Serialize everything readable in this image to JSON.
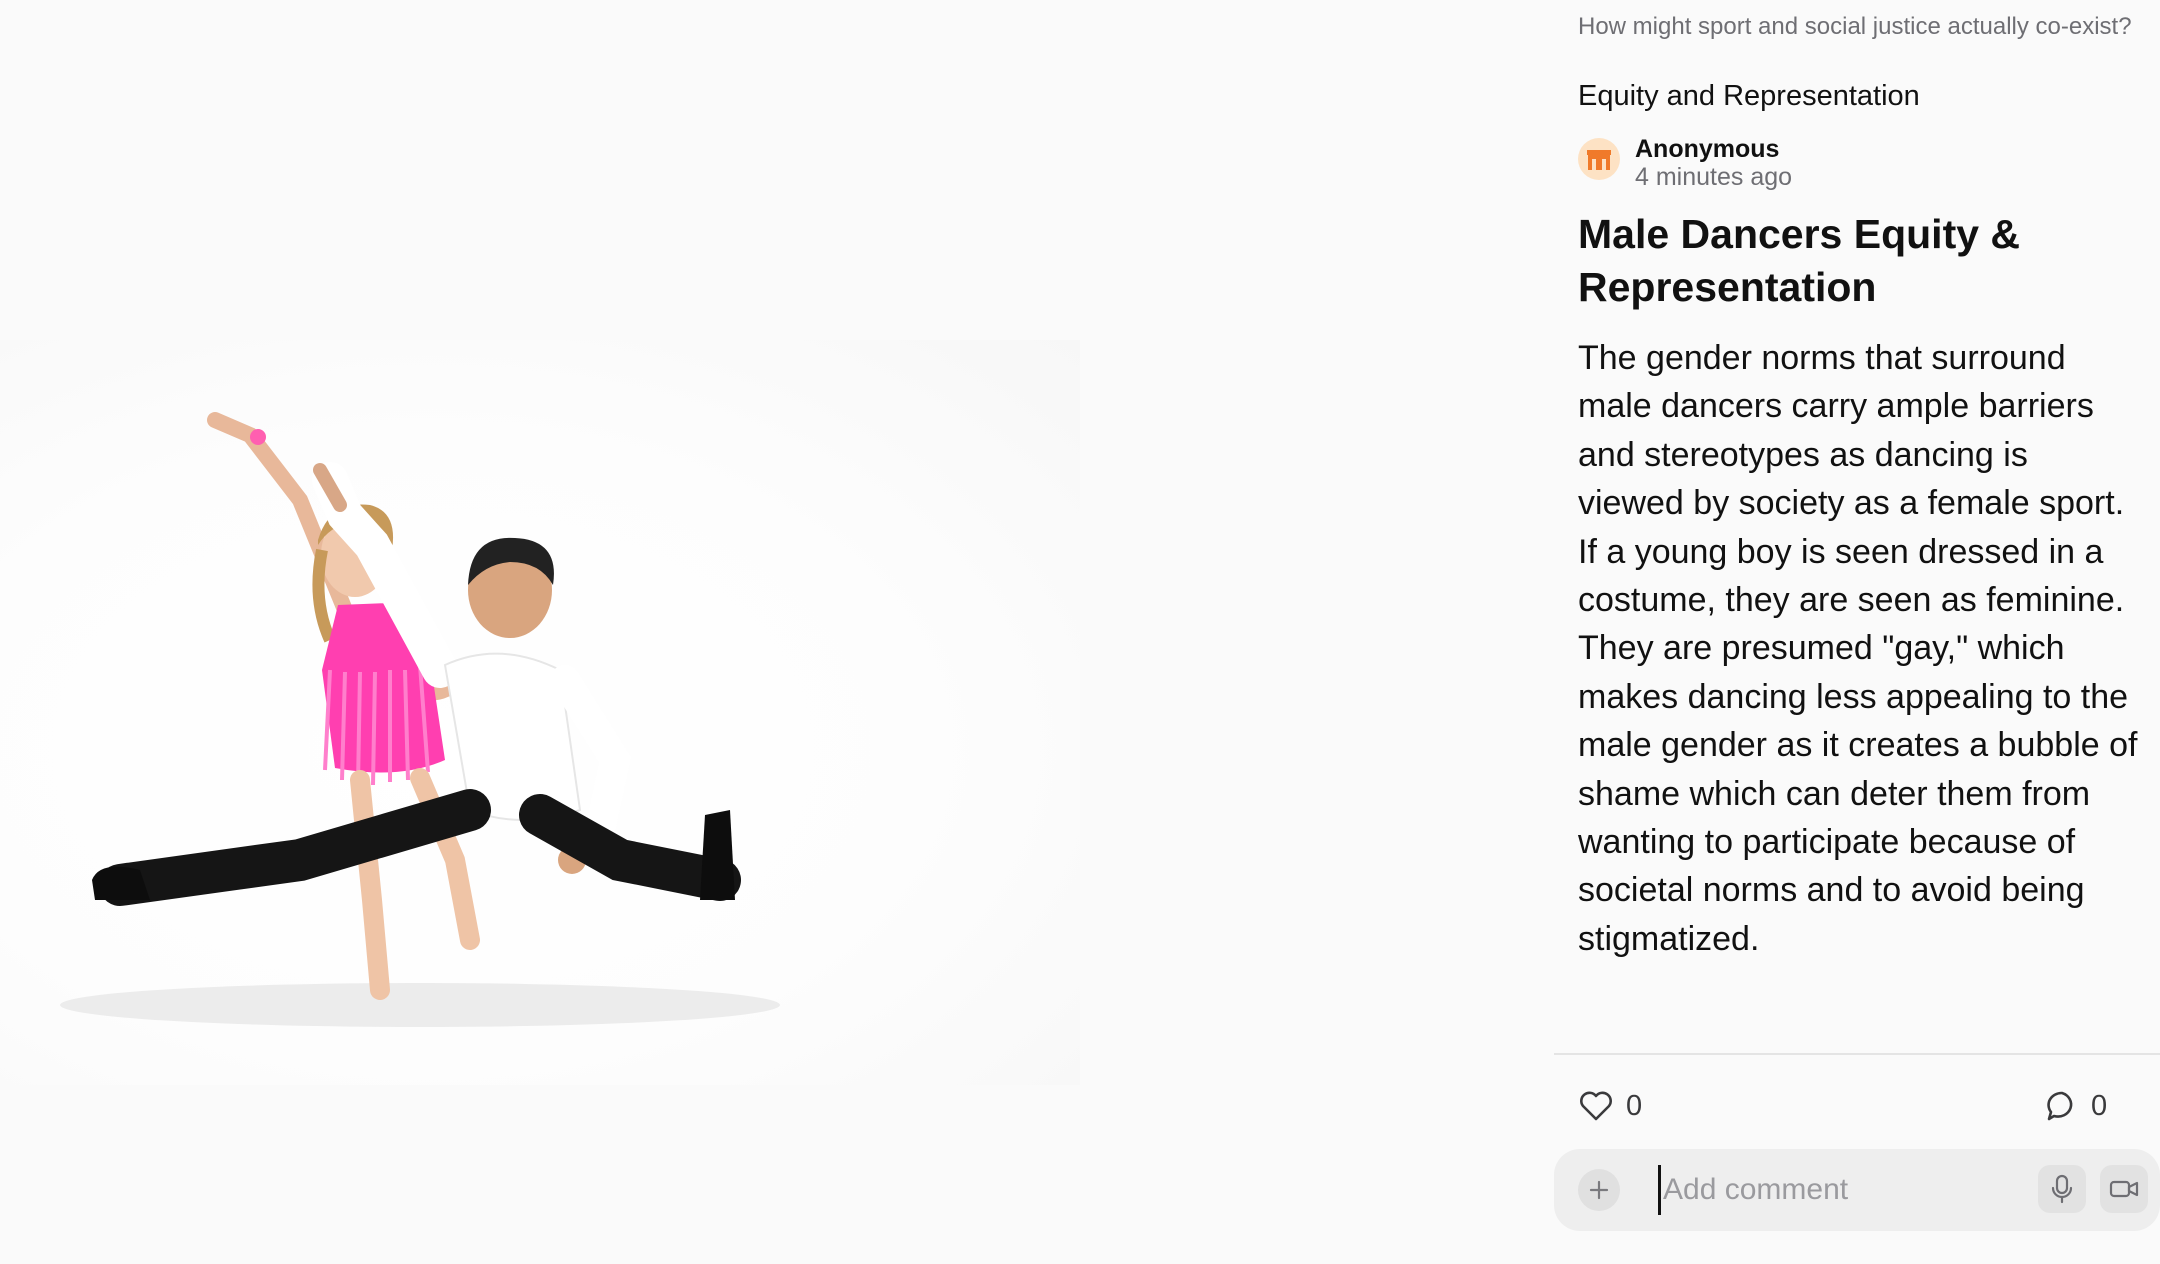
{
  "post": {
    "prompt": "How might sport and social justice actually co-exist?",
    "category": "Equity and Representation",
    "author": {
      "name": "Anonymous",
      "time": "4 minutes ago",
      "avatar_icon": "building-icon",
      "avatar_bg": "#fde2c4",
      "avatar_fg": "#f07a2a"
    },
    "title": "Male Dancers Equity & Representation",
    "body": "The gender norms that surround male dancers carry ample barriers and stereotypes as dancing is viewed by society as a female sport. If a young boy is seen dressed in a costume, they are seen as feminine. They are presumed \"gay,\" which makes dancing less appealing to the male gender as it creates a bubble of shame which can deter them from wanting to participate because of societal norms and to avoid being stigmatized."
  },
  "reactions": {
    "likes": "0",
    "like_icon": "heart-icon",
    "comments": "0",
    "comment_icon": "comment-bubble-icon"
  },
  "composer": {
    "placeholder": "Add comment",
    "add_icon": "plus-icon",
    "mic_icon": "microphone-icon",
    "video_icon": "video-camera-icon"
  },
  "colors": {
    "background": "#fafafa",
    "text": "#111111",
    "muted": "#6e6e73",
    "composer_bg": "#eeeeee"
  }
}
